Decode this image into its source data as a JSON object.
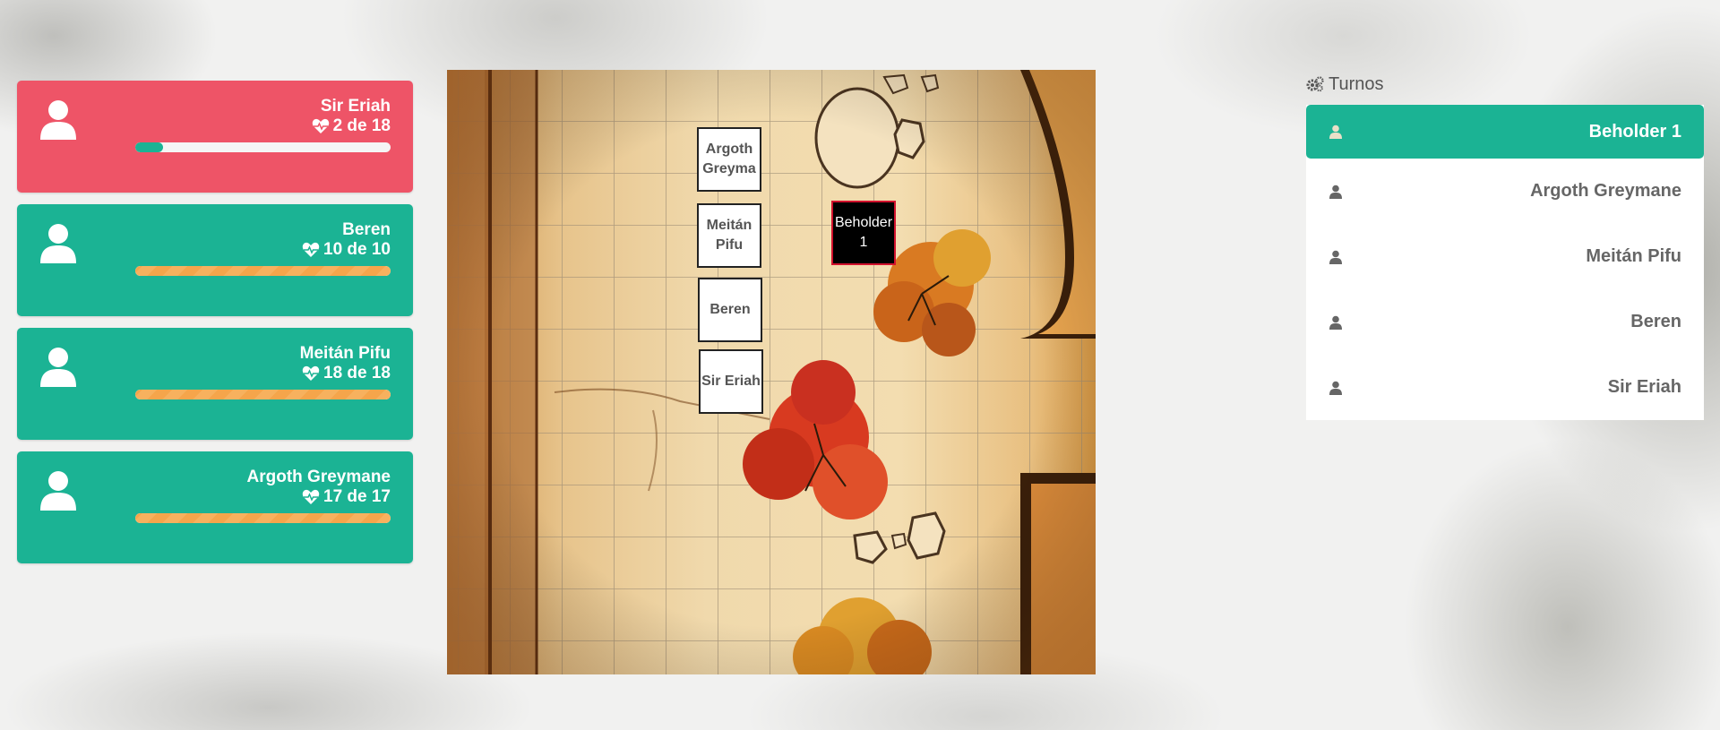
{
  "players": [
    {
      "name": "Sir Eriah",
      "hp_text": "2 de 18",
      "hp_fraction": 0.11,
      "status": "danger"
    },
    {
      "name": "Beren",
      "hp_text": "10 de 10",
      "hp_fraction": 1.0,
      "status": "ok"
    },
    {
      "name": "Meitán Pifu",
      "hp_text": "18 de 18",
      "hp_fraction": 1.0,
      "status": "ok"
    },
    {
      "name": "Argoth Greymane",
      "hp_text": "17 de 17",
      "hp_fraction": 1.0,
      "status": "ok"
    }
  ],
  "tokens": [
    {
      "label": "Argoth Greyma"
    },
    {
      "label": "Meitán Pifu"
    },
    {
      "label": "Beren"
    },
    {
      "label": "Sir Eriah"
    },
    {
      "label": "Beholder 1"
    }
  ],
  "turns": {
    "title": "Turnos",
    "icon": "cogs-icon",
    "items": [
      {
        "name": "Beholder 1"
      },
      {
        "name": "Argoth Greymane"
      },
      {
        "name": "Meitán Pifu"
      },
      {
        "name": "Beren"
      },
      {
        "name": "Sir Eriah"
      }
    ]
  },
  "colors": {
    "ok": "#1bb394",
    "danger": "#ee5467",
    "hp_bar": "#f7b15e",
    "enemy_border": "#d2122e"
  }
}
